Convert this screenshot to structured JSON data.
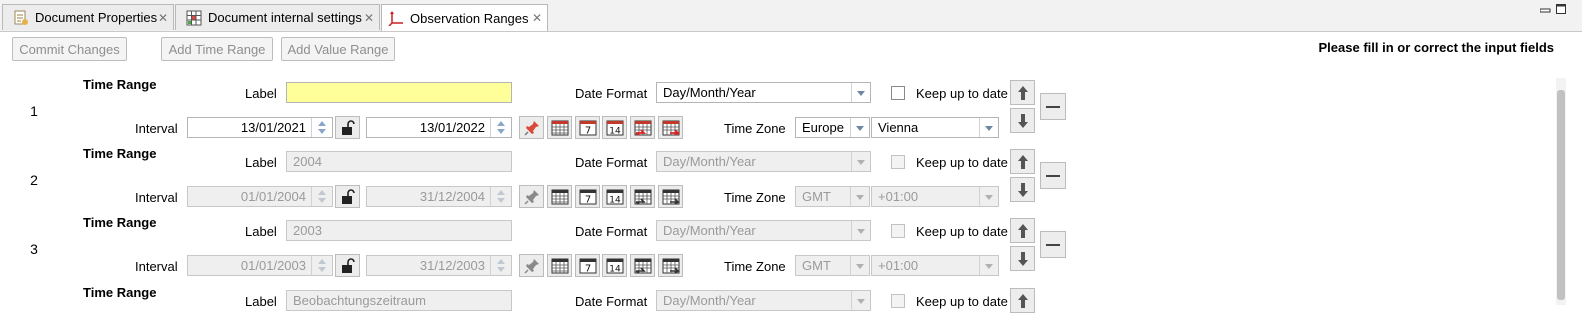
{
  "tabs": [
    {
      "label": "Document Properties",
      "icon": "document-properties-icon",
      "active": false
    },
    {
      "label": "Document internal settings",
      "icon": "grid-settings-icon",
      "active": false
    },
    {
      "label": "Observation Ranges",
      "icon": "axes-icon",
      "active": true
    }
  ],
  "toolbar": {
    "commit_label": "Commit Changes",
    "add_time_label": "Add Time Range",
    "add_value_label": "Add Value Range",
    "message": "Please fill in or correct the input fields"
  },
  "labels": {
    "section": "Time Range",
    "label": "Label",
    "date_format": "Date Format",
    "keep": "Keep up to date",
    "interval": "Interval",
    "time_zone": "Time Zone"
  },
  "ranges": [
    {
      "num": "1",
      "label_value": "",
      "date_format": "Day/Month/Year",
      "from": "13/01/2021",
      "to": "13/01/2022",
      "tz_region": "Europe",
      "tz_city": "Vienna"
    },
    {
      "num": "2",
      "label_value": "2004",
      "date_format": "Day/Month/Year",
      "from": "01/01/2004",
      "to": "31/12/2004",
      "tz_region": "GMT",
      "tz_city": "+01:00"
    },
    {
      "num": "3",
      "label_value": "2003",
      "date_format": "Day/Month/Year",
      "from": "01/01/2003",
      "to": "31/12/2003",
      "tz_region": "GMT",
      "tz_city": "+01:00"
    },
    {
      "num": "",
      "label_value": "Beobachtungszeitraum",
      "date_format": "Day/Month/Year"
    }
  ],
  "colors": {
    "required_field": "#ffff99",
    "disabled_field": "#efefef"
  }
}
